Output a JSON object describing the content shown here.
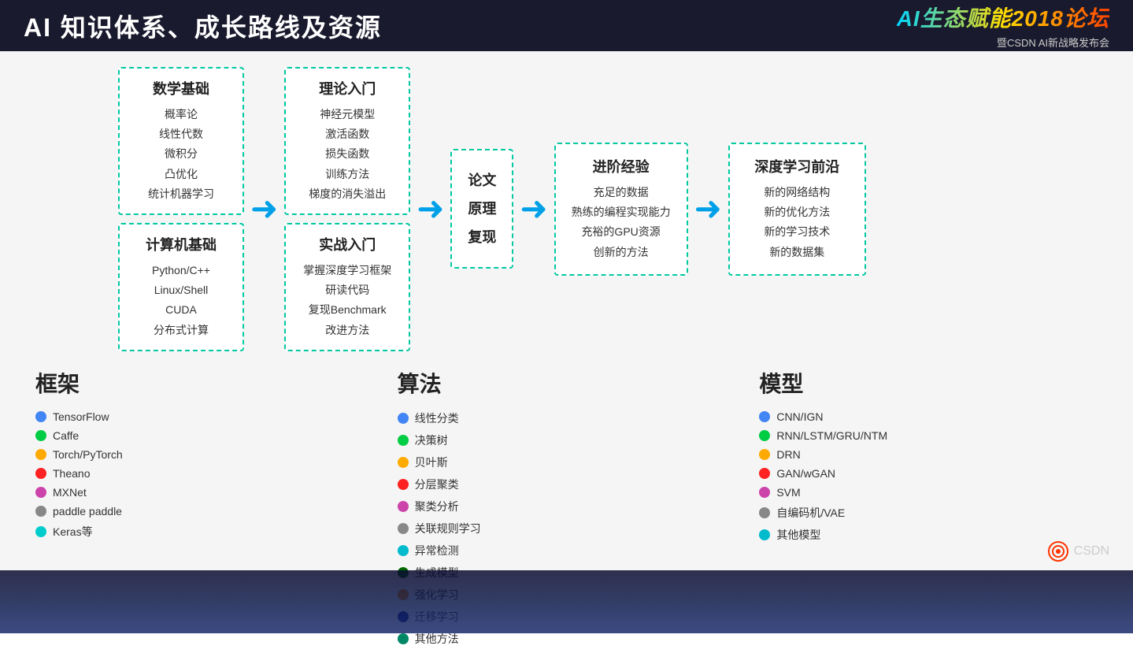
{
  "header": {
    "title": "AI 知识体系、成长路线及资源",
    "logo_main": "AI生态赋能2018论坛",
    "logo_sub": "暨CSDN AI新战略发布会"
  },
  "flow": {
    "arrow": "→",
    "box1": {
      "sections": [
        {
          "title": "数学基础",
          "items": [
            "概率论",
            "线性代数",
            "微积分",
            "凸优化",
            "统计机器学习"
          ]
        },
        {
          "title": "计算机基础",
          "items": [
            "Python/C++",
            "Linux/Shell",
            "CUDA",
            "分布式计算"
          ]
        }
      ]
    },
    "box2": {
      "sections": [
        {
          "title": "理论入门",
          "items": [
            "神经元模型",
            "激活函数",
            "损失函数",
            "训练方法",
            "梯度的消失溢出"
          ]
        },
        {
          "title": "实战入门",
          "items": [
            "掌握深度学习框架",
            "研读代码",
            "复现Benchmark",
            "改进方法"
          ]
        }
      ]
    },
    "box3": {
      "title": "论文\n原理\n复现"
    },
    "box4": {
      "title": "进阶经验",
      "items": [
        "充足的数据",
        "熟练的编程实现能力",
        "充裕的GPU资源",
        "创新的方法"
      ]
    },
    "box5": {
      "title": "深度学习前沿",
      "items": [
        "新的网络结构",
        "新的优化方法",
        "新的学习技术",
        "新的数据集"
      ]
    }
  },
  "frameworks": {
    "title": "框架",
    "items": [
      {
        "color": "#4285f4",
        "label": "TensorFlow"
      },
      {
        "color": "#00cc44",
        "label": "Caffe"
      },
      {
        "color": "#ffaa00",
        "label": "Torch/PyTorch"
      },
      {
        "color": "#ff2222",
        "label": "Theano"
      },
      {
        "color": "#cc44aa",
        "label": "MXNet"
      },
      {
        "color": "#888888",
        "label": "paddle paddle"
      },
      {
        "color": "#00cccc",
        "label": "Keras等"
      }
    ]
  },
  "algorithms": {
    "title": "算法",
    "items": [
      {
        "color": "#4285f4",
        "label": "线性分类"
      },
      {
        "color": "#00cc44",
        "label": "决策树"
      },
      {
        "color": "#ffaa00",
        "label": "贝叶斯"
      },
      {
        "color": "#ff2222",
        "label": "分层聚类"
      },
      {
        "color": "#cc44aa",
        "label": "聚类分析"
      },
      {
        "color": "#888888",
        "label": "关联规则学习"
      },
      {
        "color": "#00bbcc",
        "label": "异常检测"
      },
      {
        "color": "#006600",
        "label": "生成模型"
      },
      {
        "color": "#ff8800",
        "label": "强化学习"
      },
      {
        "color": "#001188",
        "label": "迁移学习"
      },
      {
        "color": "#008866",
        "label": "其他方法"
      }
    ]
  },
  "models": {
    "title": "模型",
    "items": [
      {
        "color": "#4285f4",
        "label": "CNN/IGN"
      },
      {
        "color": "#00cc44",
        "label": "RNN/LSTM/GRU/NTM"
      },
      {
        "color": "#ffaa00",
        "label": "DRN"
      },
      {
        "color": "#ff2222",
        "label": "GAN/wGAN"
      },
      {
        "color": "#cc44aa",
        "label": "SVM"
      },
      {
        "color": "#888888",
        "label": "自编码机/VAE"
      },
      {
        "color": "#00bbcc",
        "label": "其他模型"
      }
    ]
  },
  "csdn": {
    "label": "CSDN"
  }
}
